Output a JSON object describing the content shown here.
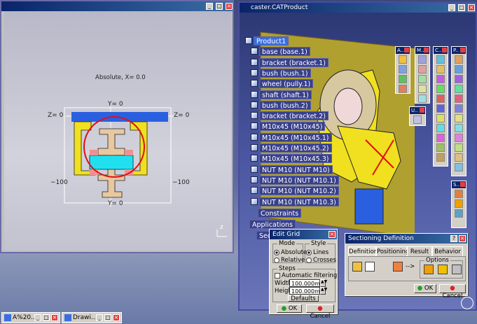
{
  "left_window": {
    "sketch_caption": "Absolute, X= 0.0",
    "labels": {
      "y_top": "Y=   0",
      "z_left": "Z=   0",
      "z_right": "Z=   0",
      "neg_left": "−100",
      "neg_right": "−100",
      "y_bottom": "Y=   0"
    },
    "axis_label": "z"
  },
  "right_window": {
    "title": "caster.CATProduct",
    "tree": [
      {
        "label": "Product1",
        "selected": true
      },
      {
        "label": "base (base.1)"
      },
      {
        "label": "bracket (bracket.1)"
      },
      {
        "label": "bush (bush.1)"
      },
      {
        "label": "wheel (pully.1)"
      },
      {
        "label": "shaft (shaft.1)"
      },
      {
        "label": "bush (bush.2)"
      },
      {
        "label": "bracket (bracket.2)"
      },
      {
        "label": "M10x45 (M10x45)"
      },
      {
        "label": "M10x45 (M10x45.1)"
      },
      {
        "label": "M10x45 (M10x45.2)"
      },
      {
        "label": "M10x45 (M10x45.3)"
      },
      {
        "label": "NUT M10 (NUT M10)"
      },
      {
        "label": "NUT M10 (NUT M10.1)"
      },
      {
        "label": "NUT M10 (NUT M10.2)"
      },
      {
        "label": "NUT M10 (NUT M10.3)"
      }
    ],
    "constraints_label": "Constraints",
    "applications_label": "Applications",
    "sec_label": "Sec"
  },
  "toolbars": {
    "a": "A..",
    "m": "M..",
    "c": "C..",
    "p": "P..",
    "u": "U..",
    "s": "S.."
  },
  "edit_grid": {
    "title": "Edit Grid",
    "mode_label": "Mode",
    "style_label": "Style",
    "absolute": "Absolute",
    "relative": "Relative",
    "lines": "Lines",
    "crosses": "Crosses",
    "steps_label": "Steps",
    "auto_filter": "Automatic filtering",
    "width_label": "Width",
    "width_value": "100.000mm",
    "height_label": "Height",
    "height_value": "100.000mm",
    "defaults": "Defaults",
    "ok": "OK",
    "cancel": "Cancel"
  },
  "sectioning": {
    "title": "Sectioning Definition",
    "tabs": [
      "Definition",
      "Positioning",
      "Result",
      "Behavior"
    ],
    "options_label": "Options",
    "ok": "OK",
    "cancel": "Cancel"
  },
  "taskbar": {
    "item1": "A%20...",
    "item2": "Drawi..."
  },
  "colors": {
    "accent_blue": "#3a6ee0",
    "part_yellow": "#f0e020",
    "part_cyan": "#20e0f0",
    "section_red": "#e01010"
  }
}
